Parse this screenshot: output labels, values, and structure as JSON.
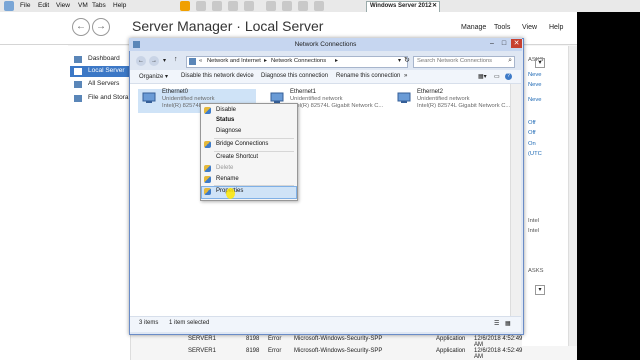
{
  "vm_menu": [
    "File",
    "Edit",
    "View",
    "VM",
    "Tabs",
    "Help"
  ],
  "vm_tab": "Windows Server 2012",
  "server_manager": {
    "title": "Server Manager · Local Server",
    "menus": [
      "Manage",
      "Tools",
      "View",
      "Help"
    ],
    "sidebar": [
      "Dashboard",
      "Local Server",
      "All Servers",
      "File and Stora"
    ],
    "right_panel_text": [
      "ASKS",
      "Neve",
      "Neve",
      "Neve",
      "Off",
      "Off",
      "On",
      "(UTC",
      "Intel",
      "Intel",
      "ASKS"
    ],
    "events": [
      {
        "server": "SERVER1",
        "id": "8198",
        "sev": "Error",
        "src": "Microsoft-Windows-Security-SPP",
        "log": "Application",
        "date": "12/6/2018 4:52:49 AM"
      },
      {
        "server": "SERVER1",
        "id": "8198",
        "sev": "Error",
        "src": "Microsoft-Windows-Security-SPP",
        "log": "Application",
        "date": "12/6/2018 4:52:49 AM"
      }
    ]
  },
  "dialog": {
    "title": "Network Connections",
    "address": [
      "«",
      "Network and Internet",
      "▸",
      "Network Connections",
      "▸"
    ],
    "search_placeholder": "Search Network Connections",
    "commands": [
      "Organize ▾",
      "Disable this network device",
      "Diagnose this connection",
      "Rename this connection",
      "»"
    ],
    "adapters": [
      {
        "name": "Ethernet0",
        "status": "Unidentified network",
        "device": "Intel(R) 82574L"
      },
      {
        "name": "Ethernet1",
        "status": "Unidentified network",
        "device": "Intel(R) 82574L Gigabit Network C..."
      },
      {
        "name": "Ethernet2",
        "status": "Unidentified network",
        "device": "Intel(R) 82574L Gigabit Network C..."
      }
    ],
    "status_items": "3 items",
    "status_selected": "1 item selected"
  },
  "context_menu": {
    "items": [
      "Disable",
      "Status",
      "Diagnose",
      "Bridge Connections",
      "Create Shortcut",
      "Delete",
      "Rename",
      "Properties"
    ]
  },
  "colors": {
    "accent": "#1f6ab5",
    "selection": "#cfe3f7"
  }
}
